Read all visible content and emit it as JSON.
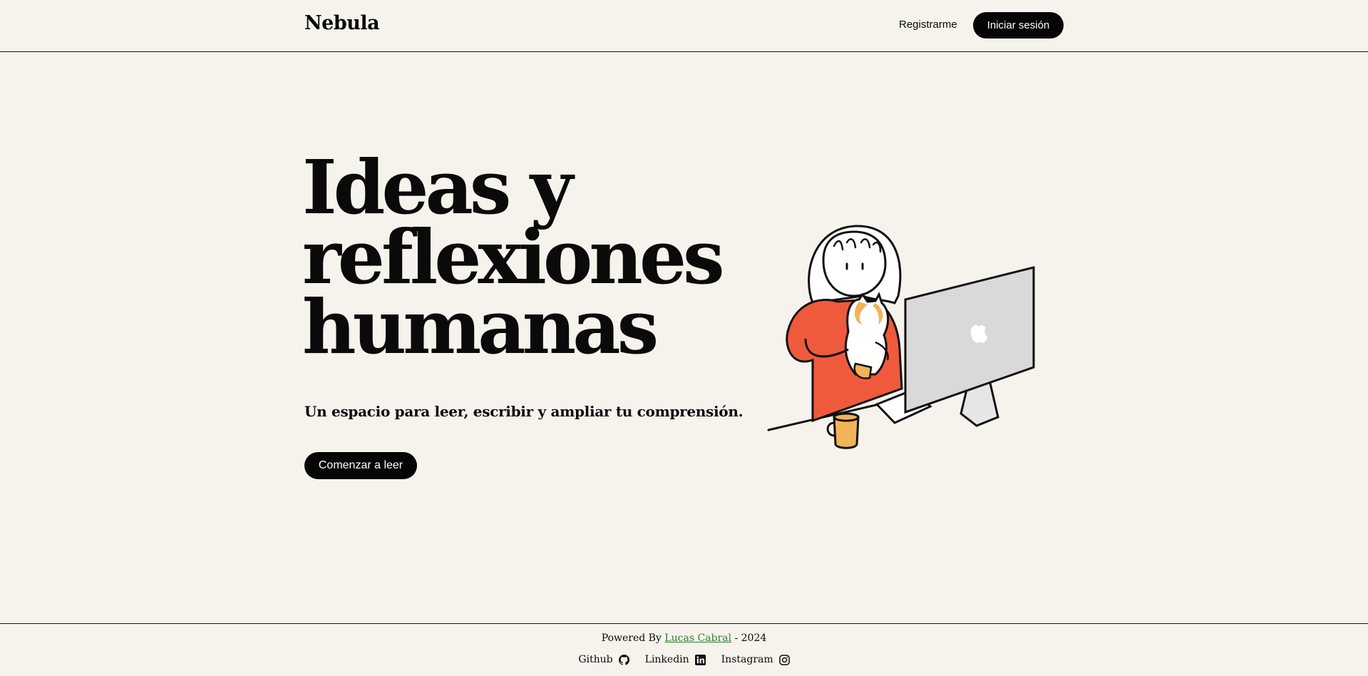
{
  "header": {
    "brand": "Nebula",
    "register_label": "Registrarme",
    "login_label": "Iniciar sesión"
  },
  "hero": {
    "title_lines": [
      "Ideas y",
      "reflexiones",
      "humanas"
    ],
    "subtitle": "Un espacio para leer, escribir y ampliar tu comprensión.",
    "cta_label": "Comenzar a leer",
    "illustration": "person-with-cat-at-computer"
  },
  "footer": {
    "powered_prefix": "Powered By",
    "author": "Lucas Cabral",
    "year_suffix": "- 2024",
    "socials": [
      {
        "label": "Github",
        "icon": "github-icon"
      },
      {
        "label": "Linkedin",
        "icon": "linkedin-icon"
      },
      {
        "label": "Instagram",
        "icon": "instagram-icon"
      }
    ]
  },
  "colors": {
    "background": "#f6f3ec",
    "primary": "#050505",
    "accent_sweater": "#f05a3c",
    "link": "#2e7d32"
  }
}
